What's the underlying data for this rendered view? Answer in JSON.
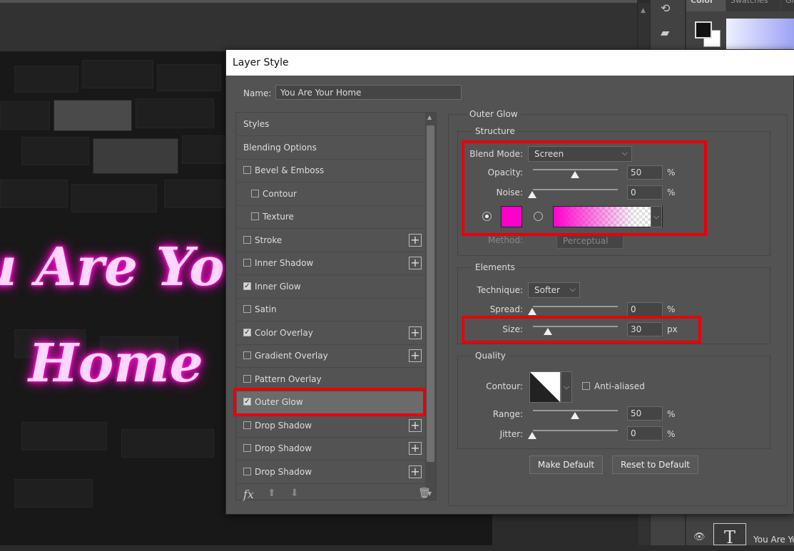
{
  "panel": {
    "tabs": [
      "Color",
      "Swatches",
      "Gr"
    ],
    "layer_name": "You Are Yo"
  },
  "canvas": {
    "line1": "u Are Yo",
    "line2": "Home"
  },
  "dialog": {
    "title": "Layer Style",
    "name_label": "Name:",
    "name_value": "You Are Your  Home",
    "styles": [
      {
        "label": "Styles",
        "checkbox": false,
        "checked": false,
        "plus": false,
        "indent": false,
        "selected": false
      },
      {
        "label": "Blending Options",
        "checkbox": false,
        "checked": false,
        "plus": false,
        "indent": false,
        "selected": false
      },
      {
        "label": "Bevel & Emboss",
        "checkbox": true,
        "checked": false,
        "plus": false,
        "indent": false,
        "selected": false
      },
      {
        "label": "Contour",
        "checkbox": true,
        "checked": false,
        "plus": false,
        "indent": true,
        "selected": false
      },
      {
        "label": "Texture",
        "checkbox": true,
        "checked": false,
        "plus": false,
        "indent": true,
        "selected": false
      },
      {
        "label": "Stroke",
        "checkbox": true,
        "checked": false,
        "plus": true,
        "indent": false,
        "selected": false
      },
      {
        "label": "Inner Shadow",
        "checkbox": true,
        "checked": false,
        "plus": true,
        "indent": false,
        "selected": false
      },
      {
        "label": "Inner Glow",
        "checkbox": true,
        "checked": true,
        "plus": false,
        "indent": false,
        "selected": false
      },
      {
        "label": "Satin",
        "checkbox": true,
        "checked": false,
        "plus": false,
        "indent": false,
        "selected": false
      },
      {
        "label": "Color Overlay",
        "checkbox": true,
        "checked": true,
        "plus": true,
        "indent": false,
        "selected": false
      },
      {
        "label": "Gradient Overlay",
        "checkbox": true,
        "checked": false,
        "plus": true,
        "indent": false,
        "selected": false
      },
      {
        "label": "Pattern Overlay",
        "checkbox": true,
        "checked": false,
        "plus": false,
        "indent": false,
        "selected": false
      },
      {
        "label": "Outer Glow",
        "checkbox": true,
        "checked": true,
        "plus": false,
        "indent": false,
        "selected": true
      },
      {
        "label": "Drop Shadow",
        "checkbox": true,
        "checked": false,
        "plus": true,
        "indent": false,
        "selected": false
      },
      {
        "label": "Drop Shadow",
        "checkbox": true,
        "checked": false,
        "plus": true,
        "indent": false,
        "selected": false
      },
      {
        "label": "Drop Shadow",
        "checkbox": true,
        "checked": false,
        "plus": true,
        "indent": false,
        "selected": false
      }
    ],
    "fx_label": "fx",
    "outer_glow": {
      "title": "Outer Glow",
      "structure": {
        "title": "Structure",
        "blend_mode_label": "Blend Mode:",
        "blend_mode": "Screen",
        "opacity_label": "Opacity:",
        "opacity": "50",
        "noise_label": "Noise:",
        "noise": "0",
        "percent": "%",
        "glow_color": "#ff00cc",
        "method_label": "Method:",
        "method": "Perceptual"
      },
      "elements": {
        "title": "Elements",
        "technique_label": "Technique:",
        "technique": "Softer",
        "spread_label": "Spread:",
        "spread": "0",
        "size_label": "Size:",
        "size": "30",
        "px": "px",
        "percent": "%"
      },
      "quality": {
        "title": "Quality",
        "contour_label": "Contour:",
        "anti_aliased_label": "Anti-aliased",
        "range_label": "Range:",
        "range": "50",
        "jitter_label": "Jitter:",
        "jitter": "0",
        "percent": "%"
      },
      "make_default": "Make Default",
      "reset_default": "Reset to Default"
    },
    "highlight_color": "#e8000a"
  }
}
